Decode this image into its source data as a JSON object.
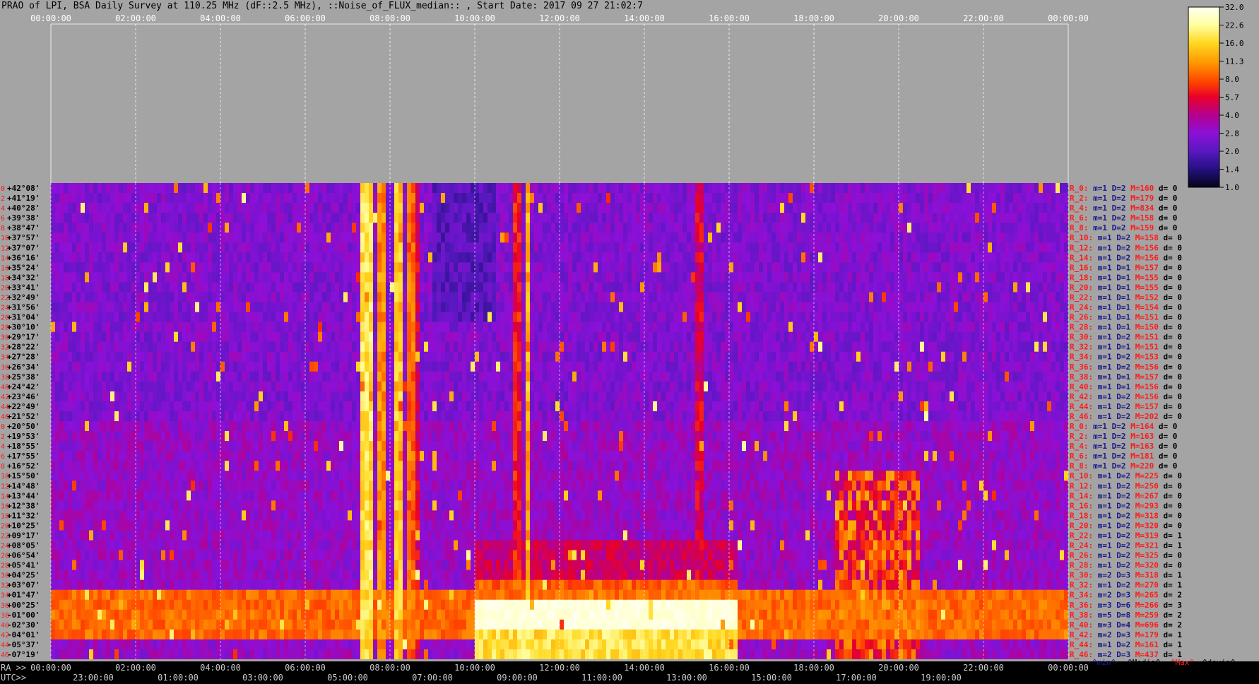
{
  "title": "PRAO of LPI, BSA Daily Survey at 110.25 MHz (dF::2.5 MHz), ::Noise_of_FLUX_median:: , Start Date: 2017 09 27 21:02:7",
  "colors": {
    "background": "#a4a4a4",
    "axis_text": "#ffffff",
    "row_label_red": "#ff1a1a",
    "row_label_blue": "#1a1a8c",
    "bottom_black": "#000000"
  },
  "chart_data": {
    "type": "heatmap",
    "title": "PRAO of LPI, BSA Daily Survey at 110.25 MHz (dF::2.5 MHz), ::Noise_of_FLUX_median:: , Start Date: 2017 09 27 21:02:7",
    "top_axis_labels": [
      "00:00:00",
      "02:00:00",
      "04:00:00",
      "06:00:00",
      "08:00:00",
      "10:00:00",
      "12:00:00",
      "14:00:00",
      "16:00:00",
      "18:00:00",
      "20:00:00",
      "22:00:00",
      "00:00:00"
    ],
    "bottom_ra_prefix": "RA >>",
    "bottom_ra_labels": [
      "00:00:00",
      "02:00:00",
      "04:00:00",
      "06:00:00",
      "08:00:00",
      "10:00:00",
      "12:00:00",
      "14:00:00",
      "16:00:00",
      "18:00:00",
      "20:00:00",
      "22:00:00",
      "00:00:00"
    ],
    "bottom_utc_prefix": "UTC>>",
    "bottom_utc_labels": [
      "23:00:00",
      "01:00:00",
      "03:00:00",
      "05:00:00",
      "07:00:00",
      "09:00:00",
      "11:00:00",
      "13:00:00",
      "15:00:00",
      "17:00:00",
      "19:00:00"
    ],
    "declinations": [
      "+42°08'",
      "+41°19'",
      "+40°28'",
      "+39°38'",
      "+38°47'",
      "+37°57'",
      "+37°07'",
      "+36°16'",
      "+35°24'",
      "+34°32'",
      "+33°41'",
      "+32°49'",
      "+31°56'",
      "+31°04'",
      "+30°10'",
      "+29°17'",
      "+28°22'",
      "+27°28'",
      "+26°34'",
      "+25°38'",
      "+24°42'",
      "+23°46'",
      "+22°49'",
      "+21°52'",
      "+20°50'",
      "+19°53'",
      "+18°55'",
      "+17°55'",
      "+16°52'",
      "+15°50'",
      "+14°48'",
      "+13°44'",
      "+12°38'",
      "+11°32'",
      "+10°25'",
      "+09°17'",
      "+08°05'",
      "+06°54'",
      "+05°41'",
      "+04°25'",
      "+03°07'",
      "+01°47'",
      "+00°25'",
      "-01°00'",
      "-02°30'",
      "-04°01'",
      "-05°37'",
      "-07°19'"
    ],
    "row_stats": [
      {
        "r": "R_0:",
        "m": "m=1",
        "d": "D=2",
        "M": "M=160",
        "dv": "d= 0"
      },
      {
        "r": "R_2:",
        "m": "m=1",
        "d": "D=2",
        "M": "M=179",
        "dv": "d= 0"
      },
      {
        "r": "R_4:",
        "m": "m=1",
        "d": "D=2",
        "M": "M=834",
        "dv": "d= 0"
      },
      {
        "r": "R_6:",
        "m": "m=1",
        "d": "D=2",
        "M": "M=158",
        "dv": "d= 0"
      },
      {
        "r": "R_8:",
        "m": "m=1",
        "d": "D=2",
        "M": "M=159",
        "dv": "d= 0"
      },
      {
        "r": "R_10:",
        "m": "m=1",
        "d": "D=2",
        "M": "M=158",
        "dv": "d= 0"
      },
      {
        "r": "R_12:",
        "m": "m=1",
        "d": "D=2",
        "M": "M=156",
        "dv": "d= 0"
      },
      {
        "r": "R_14:",
        "m": "m=1",
        "d": "D=2",
        "M": "M=156",
        "dv": "d= 0"
      },
      {
        "r": "R_16:",
        "m": "m=1",
        "d": "D=1",
        "M": "M=157",
        "dv": "d= 0"
      },
      {
        "r": "R_18:",
        "m": "m=1",
        "d": "D=1",
        "M": "M=155",
        "dv": "d= 0"
      },
      {
        "r": "R_20:",
        "m": "m=1",
        "d": "D=1",
        "M": "M=155",
        "dv": "d= 0"
      },
      {
        "r": "R_22:",
        "m": "m=1",
        "d": "D=1",
        "M": "M=152",
        "dv": "d= 0"
      },
      {
        "r": "R_24:",
        "m": "m=1",
        "d": "D=1",
        "M": "M=154",
        "dv": "d= 0"
      },
      {
        "r": "R_26:",
        "m": "m=1",
        "d": "D=1",
        "M": "M=151",
        "dv": "d= 0"
      },
      {
        "r": "R_28:",
        "m": "m=1",
        "d": "D=1",
        "M": "M=150",
        "dv": "d= 0"
      },
      {
        "r": "R_30:",
        "m": "m=1",
        "d": "D=2",
        "M": "M=151",
        "dv": "d= 0"
      },
      {
        "r": "R_32:",
        "m": "m=1",
        "d": "D=1",
        "M": "M=151",
        "dv": "d= 0"
      },
      {
        "r": "R_34:",
        "m": "m=1",
        "d": "D=2",
        "M": "M=153",
        "dv": "d= 0"
      },
      {
        "r": "R_36:",
        "m": "m=1",
        "d": "D=2",
        "M": "M=156",
        "dv": "d= 0"
      },
      {
        "r": "R_38:",
        "m": "m=1",
        "d": "D=1",
        "M": "M=157",
        "dv": "d= 0"
      },
      {
        "r": "R_40:",
        "m": "m=1",
        "d": "D=1",
        "M": "M=156",
        "dv": "d= 0"
      },
      {
        "r": "R_42:",
        "m": "m=1",
        "d": "D=2",
        "M": "M=156",
        "dv": "d= 0"
      },
      {
        "r": "R_44:",
        "m": "m=1",
        "d": "D=2",
        "M": "M=157",
        "dv": "d= 0"
      },
      {
        "r": "R_46:",
        "m": "m=1",
        "d": "D=2",
        "M": "M=202",
        "dv": "d= 0"
      },
      {
        "r": "R_0:",
        "m": "m=1",
        "d": "D=2",
        "M": "M=164",
        "dv": "d= 0"
      },
      {
        "r": "R_2:",
        "m": "m=1",
        "d": "D=2",
        "M": "M=163",
        "dv": "d= 0"
      },
      {
        "r": "R_4:",
        "m": "m=1",
        "d": "D=2",
        "M": "M=163",
        "dv": "d= 0"
      },
      {
        "r": "R_6:",
        "m": "m=1",
        "d": "D=2",
        "M": "M=181",
        "dv": "d= 0"
      },
      {
        "r": "R_8:",
        "m": "m=1",
        "d": "D=2",
        "M": "M=220",
        "dv": "d= 0"
      },
      {
        "r": "R_10:",
        "m": "m=1",
        "d": "D=2",
        "M": "M=225",
        "dv": "d= 0"
      },
      {
        "r": "R_12:",
        "m": "m=1",
        "d": "D=2",
        "M": "M=250",
        "dv": "d= 0"
      },
      {
        "r": "R_14:",
        "m": "m=1",
        "d": "D=2",
        "M": "M=267",
        "dv": "d= 0"
      },
      {
        "r": "R_16:",
        "m": "m=1",
        "d": "D=2",
        "M": "M=293",
        "dv": "d= 0"
      },
      {
        "r": "R_18:",
        "m": "m=1",
        "d": "D=2",
        "M": "M=318",
        "dv": "d= 0"
      },
      {
        "r": "R_20:",
        "m": "m=1",
        "d": "D=2",
        "M": "M=320",
        "dv": "d= 0"
      },
      {
        "r": "R_22:",
        "m": "m=1",
        "d": "D=2",
        "M": "M=319",
        "dv": "d= 1"
      },
      {
        "r": "R_24:",
        "m": "m=1",
        "d": "D=2",
        "M": "M=321",
        "dv": "d= 1"
      },
      {
        "r": "R_26:",
        "m": "m=1",
        "d": "D=2",
        "M": "M=325",
        "dv": "d= 0"
      },
      {
        "r": "R_28:",
        "m": "m=1",
        "d": "D=2",
        "M": "M=320",
        "dv": "d= 0"
      },
      {
        "r": "R_30:",
        "m": "m=2",
        "d": "D=3",
        "M": "M=318",
        "dv": "d= 1"
      },
      {
        "r": "R_32:",
        "m": "m=1",
        "d": "D=2",
        "M": "M=270",
        "dv": "d= 1"
      },
      {
        "r": "R_34:",
        "m": "m=2",
        "d": "D=3",
        "M": "M=265",
        "dv": "d= 2"
      },
      {
        "r": "R_36:",
        "m": "m=3",
        "d": "D=6",
        "M": "M=266",
        "dv": "d= 3"
      },
      {
        "r": "R_38:",
        "m": "m=5",
        "d": "D=8",
        "M": "M=259",
        "dv": "d= 2"
      },
      {
        "r": "R_40:",
        "m": "m=3",
        "d": "D=4",
        "M": "M=696",
        "dv": "d= 2"
      },
      {
        "r": "R_42:",
        "m": "m=2",
        "d": "D=3",
        "M": "M=179",
        "dv": "d= 1"
      },
      {
        "r": "R_44:",
        "m": "m=1",
        "d": "D=2",
        "M": "M=161",
        "dv": "d= 1"
      },
      {
        "r": "R_46:",
        "m": "m=2",
        "d": "D=3",
        "M": "M=437",
        "dv": "d= 1"
      }
    ],
    "left_row_numbers": [
      "0",
      "2",
      "4",
      "6",
      "8",
      "10",
      "12",
      "14",
      "16",
      "18",
      "20",
      "22",
      "24",
      "26",
      "28",
      "30",
      "32",
      "34",
      "36",
      "38",
      "40",
      "42",
      "44",
      "46",
      "0",
      "2",
      "4",
      "6",
      "8",
      "10",
      "12",
      "14",
      "16",
      "18",
      "20",
      "22",
      "24",
      "26",
      "28",
      "30",
      "32",
      "34",
      "36",
      "38",
      "40",
      "42",
      "44",
      "46"
    ],
    "stats_footer": [
      "^min^",
      "^Media^",
      "^Max^",
      "^devia^"
    ],
    "colorbar": {
      "labels": [
        "32.0",
        "22.6",
        "16.0",
        "11.3",
        "8.0",
        "5.7",
        "4.0",
        "2.8",
        "2.0",
        "1.4",
        "1.0"
      ],
      "stops": [
        {
          "pos": 0.0,
          "color": "#fffff0"
        },
        {
          "pos": 0.1,
          "color": "#ffffa0"
        },
        {
          "pos": 0.2,
          "color": "#ffd820"
        },
        {
          "pos": 0.32,
          "color": "#ff9000"
        },
        {
          "pos": 0.42,
          "color": "#ff4000"
        },
        {
          "pos": 0.5,
          "color": "#e8002a"
        },
        {
          "pos": 0.6,
          "color": "#b40090"
        },
        {
          "pos": 0.7,
          "color": "#8c10d8"
        },
        {
          "pos": 0.8,
          "color": "#5818c0"
        },
        {
          "pos": 0.9,
          "color": "#241080"
        },
        {
          "pos": 1.0,
          "color": "#04041a"
        }
      ]
    }
  }
}
